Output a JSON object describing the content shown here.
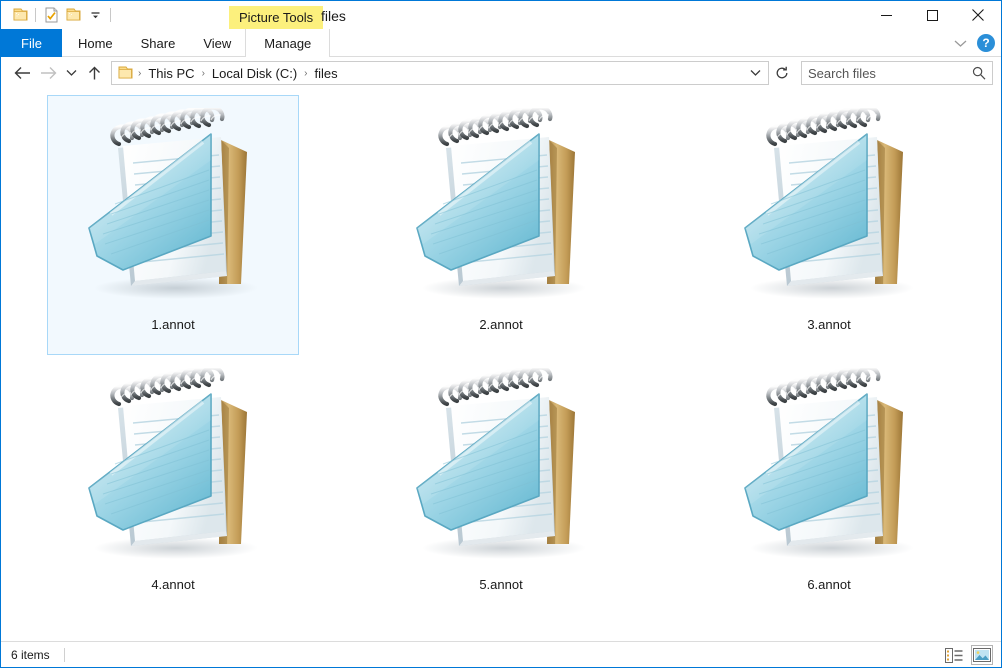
{
  "window": {
    "title": "files",
    "contextual_tab_group": "Picture Tools",
    "controls": {
      "minimize": "minimize-button",
      "maximize": "maximize-button",
      "close": "close-button"
    }
  },
  "quick_access": {
    "items": [
      {
        "name": "folder-icon",
        "label": "Folder"
      },
      {
        "name": "properties-icon",
        "label": "Properties"
      },
      {
        "name": "new-folder-icon",
        "label": "New folder"
      },
      {
        "name": "customize-chevron-icon",
        "label": "Customize Quick Access Toolbar"
      }
    ]
  },
  "ribbon": {
    "tabs": [
      {
        "label": "File",
        "active": true
      },
      {
        "label": "Home",
        "active": false
      },
      {
        "label": "Share",
        "active": false
      },
      {
        "label": "View",
        "active": false
      },
      {
        "label": "Manage",
        "active": false
      }
    ],
    "collapse_label": "Minimize the Ribbon",
    "help_label": "?"
  },
  "address": {
    "back_label": "Back",
    "forward_label": "Forward",
    "recent_label": "Recent locations",
    "up_label": "Up",
    "breadcrumbs": [
      "This PC",
      "Local Disk (C:)",
      "files"
    ],
    "separator": "›",
    "dropdown_label": "Previous locations",
    "refresh_label": "Refresh"
  },
  "search": {
    "placeholder": "Search files",
    "icon": "search-icon"
  },
  "files": [
    {
      "name": "1.annot",
      "selected": true
    },
    {
      "name": "2.annot",
      "selected": false
    },
    {
      "name": "3.annot",
      "selected": false
    },
    {
      "name": "4.annot",
      "selected": false
    },
    {
      "name": "5.annot",
      "selected": false
    },
    {
      "name": "6.annot",
      "selected": false
    }
  ],
  "status": {
    "item_count": "6 items"
  },
  "view_buttons": [
    {
      "name": "details-view-button",
      "label": "Details view",
      "active": false
    },
    {
      "name": "large-icons-view-button",
      "label": "Large icons view",
      "active": true
    }
  ],
  "colors": {
    "accent": "#0078d7",
    "contextual_tab": "#fcf07d",
    "selection_fill": "#f2f9fe",
    "selection_border": "#a8d8f8"
  }
}
